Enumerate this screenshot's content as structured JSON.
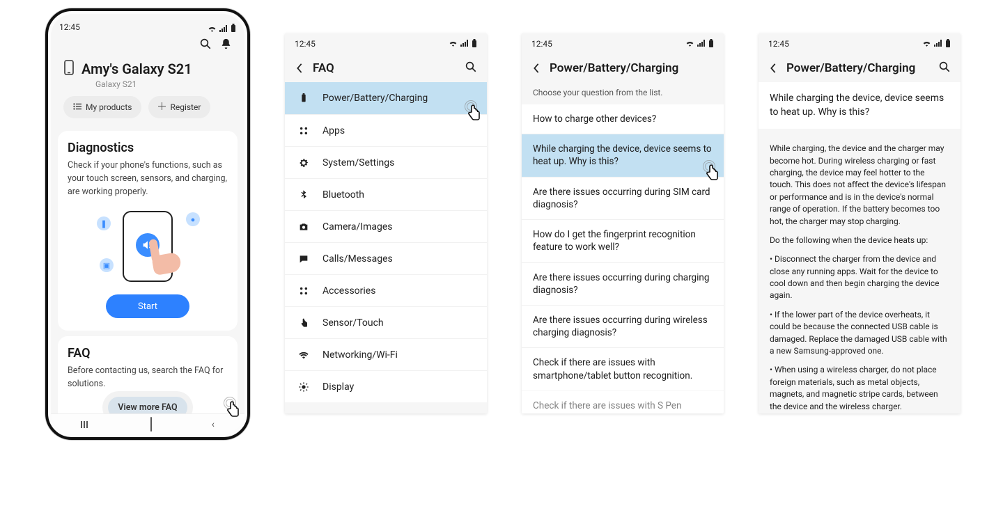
{
  "status": {
    "time": "12:45"
  },
  "phone1": {
    "device_title": "Amy's Galaxy S21",
    "device_model": "Galaxy S21",
    "chip_my_products": "My products",
    "chip_register": "Register",
    "diag_title": "Diagnostics",
    "diag_body": "Check if your phone's functions, such as your touch screen, sensors, and charging, are working properly.",
    "start_label": "Start",
    "faq_title": "FAQ",
    "faq_body": "Before contacting us, search the FAQ for solutions.",
    "view_more_label": "View more FAQ"
  },
  "faq_panel": {
    "title": "FAQ",
    "items": [
      {
        "icon": "battery",
        "label": "Power/Battery/Charging",
        "selected": true
      },
      {
        "icon": "apps",
        "label": "Apps"
      },
      {
        "icon": "gear",
        "label": "System/Settings"
      },
      {
        "icon": "bt",
        "label": "Bluetooth"
      },
      {
        "icon": "camera",
        "label": "Camera/Images"
      },
      {
        "icon": "msg",
        "label": "Calls/Messages"
      },
      {
        "icon": "acc",
        "label": "Accessories"
      },
      {
        "icon": "touch",
        "label": "Sensor/Touch"
      },
      {
        "icon": "wifi",
        "label": "Networking/Wi-Fi"
      },
      {
        "icon": "bright",
        "label": "Display"
      }
    ]
  },
  "q_panel": {
    "title": "Power/Battery/Charging",
    "hint": "Choose your question from the list.",
    "items": [
      "How to charge other devices?",
      "While charging the device, device seems to heat up. Why is this?",
      "Are there issues occurring during SIM card diagnosis?",
      "How do I get the fingerprint recognition feature to work well?",
      "Are there issues occurring during charging diagnosis?",
      "Are there issues occurring during wireless charging diagnosis?",
      "Check if there are issues with smartphone/tablet button recognition.",
      "Check if there are issues with S Pen recognition"
    ],
    "selected_index": 1
  },
  "answer_panel": {
    "title": "Power/Battery/Charging",
    "question": "While charging the device, device seems to heat up. Why is this?",
    "paragraphs": [
      "While charging, the device and the charger may become hot. During wireless charging or fast charging, the device may feel hotter to the touch. This does not affect the device's lifespan or performance and is in the device's normal range of operation. If the battery becomes too hot, the charger may stop charging.",
      "Do the following when the device heats up:",
      "• Disconnect the charger from the device and close any running apps. Wait for the device to cool down and then begin charging the device again.",
      "• If the lower part of the device overheats, it could be because the connected USB cable is damaged. Replace the damaged USB cable with a new Samsung-approved one.",
      "• When using a wireless charger, do not place foreign materials, such as metal objects, magnets, and magnetic stripe cards, between the device and the wireless charger."
    ]
  }
}
